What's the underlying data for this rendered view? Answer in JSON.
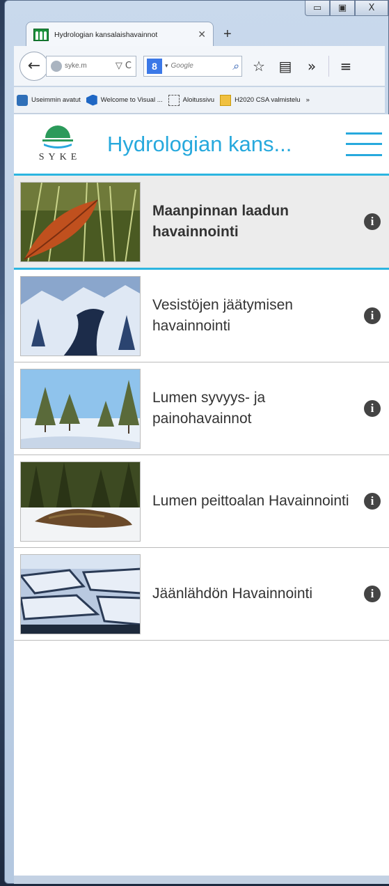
{
  "browser": {
    "caption": {
      "minimize": "▭",
      "maximize": "▣",
      "close": "X"
    },
    "tab": {
      "title": "Hydrologian kansalaishavainnot",
      "close": "✕",
      "new_tab": "+"
    },
    "nav": {
      "back": "←",
      "url": "syke.m",
      "dropdown": "▽",
      "reload": "C",
      "search_engine": "8",
      "search_placeholder": "Google",
      "search_icon": "⌕",
      "star": "☆",
      "reader": "▤",
      "overflow": "»",
      "menu": "≡"
    },
    "bookmarks": [
      {
        "label": "Useimmin avatut",
        "icon": "blue"
      },
      {
        "label": "Welcome to Visual ...",
        "icon": "vs"
      },
      {
        "label": "Aloitussivu",
        "icon": "dash"
      },
      {
        "label": "H2020 CSA valmistelu",
        "icon": "folder"
      }
    ],
    "bookmarks_overflow": "»"
  },
  "app": {
    "logo_text": "SYKE",
    "title": "Hydrologian kans...",
    "items": [
      {
        "label": "Maanpinnan laadun havainnointi",
        "selected": true,
        "image": "autumn-leaf",
        "info": "i"
      },
      {
        "label": "Vesistöjen jäätymisen havainnointi",
        "selected": false,
        "image": "frozen-stream",
        "info": "i"
      },
      {
        "label": "Lumen syvyys- ja painohavainnot",
        "selected": false,
        "image": "snowy-forest",
        "info": "i"
      },
      {
        "label": "Lumen peittoalan Havainnointi",
        "selected": false,
        "image": "snow-patch",
        "info": "i"
      },
      {
        "label": "Jäänlähdön Havainnointi",
        "selected": false,
        "image": "ice-breakup",
        "info": "i"
      }
    ]
  },
  "colors": {
    "accent": "#27a9dd",
    "selected_bg": "#ececec",
    "info_icon": "#444444"
  }
}
